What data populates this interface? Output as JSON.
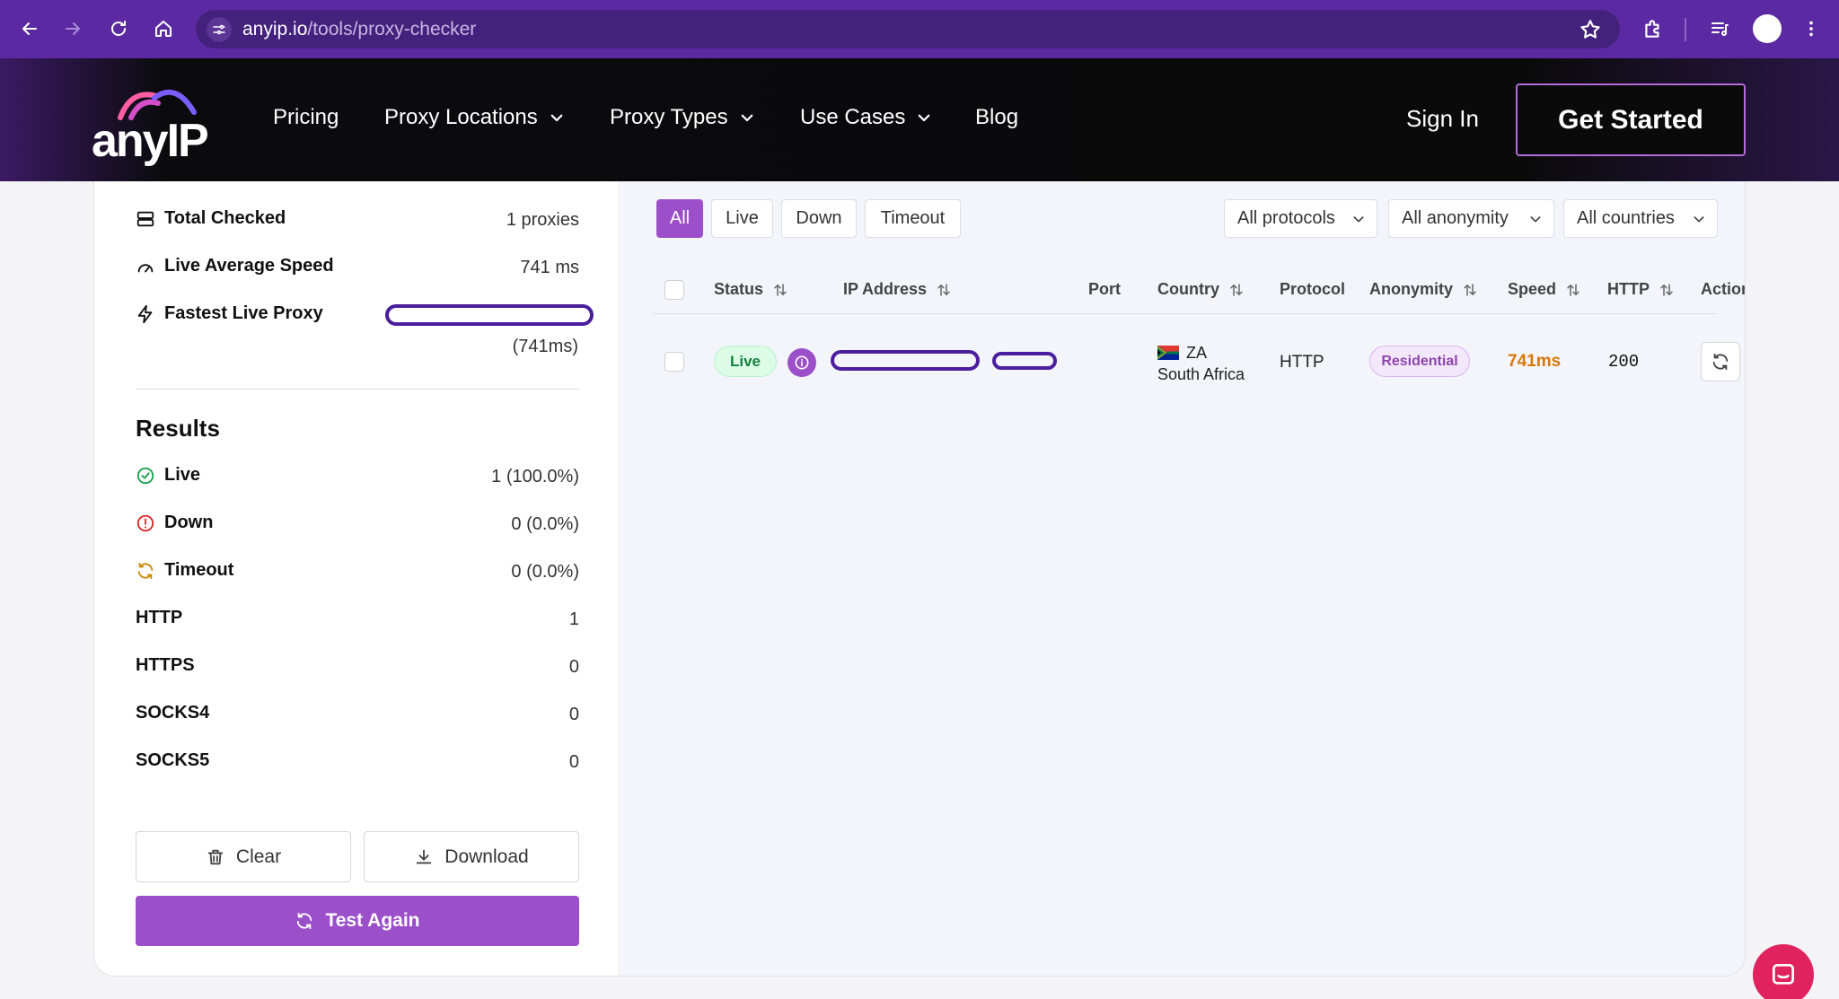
{
  "browser": {
    "url_host": "anyip.io",
    "url_path": "/tools/proxy-checker"
  },
  "header": {
    "logo_text": "anyIP",
    "nav": [
      {
        "label": "Pricing"
      },
      {
        "label": "Proxy Locations"
      },
      {
        "label": "Proxy Types"
      },
      {
        "label": "Use Cases"
      },
      {
        "label": "Blog"
      }
    ],
    "sign_in": "Sign In",
    "get_started": "Get Started"
  },
  "summary": {
    "total_checked_label": "Total Checked",
    "total_checked_value": "1 proxies",
    "live_avg_label": "Live Average Speed",
    "live_avg_value": "741 ms",
    "fastest_label": "Fastest Live Proxy",
    "fastest_value": "(741ms)"
  },
  "results": {
    "title": "Results",
    "rows": [
      {
        "label": "Live",
        "value": "1 (100.0%)"
      },
      {
        "label": "Down",
        "value": "0 (0.0%)"
      },
      {
        "label": "Timeout",
        "value": "0 (0.0%)"
      },
      {
        "label": "HTTP",
        "value": "1"
      },
      {
        "label": "HTTPS",
        "value": "0"
      },
      {
        "label": "SOCKS4",
        "value": "0"
      },
      {
        "label": "SOCKS5",
        "value": "0"
      }
    ]
  },
  "buttons": {
    "clear": "Clear",
    "download": "Download",
    "test_again": "Test Again"
  },
  "filters": {
    "tabs": [
      "All",
      "Live",
      "Down",
      "Timeout"
    ],
    "active_tab": "All",
    "protocol": "All protocols",
    "anonymity": "All anonymity",
    "countries": "All countries"
  },
  "table": {
    "headers": [
      "Status",
      "IP Address",
      "Port",
      "Country",
      "Protocol",
      "Anonymity",
      "Speed",
      "HTTP",
      "Actions"
    ],
    "rows": [
      {
        "status": "Live",
        "country_code": "ZA",
        "country_name": "South Africa",
        "protocol": "HTTP",
        "anonymity": "Residential",
        "speed": "741ms",
        "http": "200"
      }
    ]
  },
  "colors": {
    "brand_purple": "#9b4fc9",
    "browser_purple": "#5b2aa3",
    "live_green": "#16a34a",
    "down_red": "#dc2626",
    "timeout_amber": "#ca8a04",
    "chat_pink": "#e0235f"
  },
  "icons": {
    "back": "arrow-left-icon",
    "forward": "arrow-right-icon",
    "reload": "reload-icon",
    "home": "home-icon",
    "bookmark": "star-icon",
    "extensions": "puzzle-icon",
    "chat": "chat-icon"
  }
}
